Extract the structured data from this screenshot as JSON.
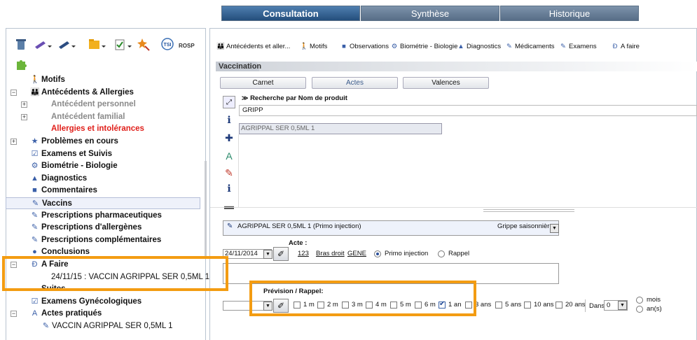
{
  "tabs": [
    {
      "label": "Consultation",
      "active": true
    },
    {
      "label": "Synthèse",
      "active": false
    },
    {
      "label": "Historique",
      "active": false
    }
  ],
  "left_toolbar": {
    "icons": [
      "trash-icon",
      "pen-blue-icon",
      "pen-dark-icon",
      "folder-icon",
      "checklist-icon",
      "star-magic-icon",
      "tsi-icon",
      "rosp-icon",
      "puzzle-icon"
    ],
    "tsi_label": "TSI",
    "rosp_label": "ROSP"
  },
  "tree": [
    {
      "label": "Motifs",
      "bold": true,
      "icon": "motifs-icon",
      "glyph": "🚶",
      "exp": "",
      "indent": 0
    },
    {
      "label": "Antécédents & Allergies",
      "bold": true,
      "icon": "antecedents-icon",
      "glyph": "👪",
      "exp": "⊟",
      "indent": 0
    },
    {
      "label": "Antécédent personnel",
      "bold": true,
      "icon": "",
      "glyph": "",
      "exp": "⊞",
      "indent": 1,
      "color": "#8a8a8a"
    },
    {
      "label": "Antécédent familial",
      "bold": true,
      "icon": "",
      "glyph": "",
      "exp": "⊞",
      "indent": 1,
      "color": "#8a8a8a"
    },
    {
      "label": "Allergies et intolérances",
      "bold": true,
      "icon": "",
      "glyph": "",
      "exp": "",
      "indent": 1,
      "color": "#e0201b"
    },
    {
      "label": "Problèmes en cours",
      "bold": true,
      "icon": "problems-icon",
      "glyph": "★",
      "exp": "⊞",
      "indent": 0
    },
    {
      "label": "Examens et Suivis",
      "bold": true,
      "icon": "exams-icon",
      "glyph": "☑",
      "exp": "",
      "indent": 0
    },
    {
      "label": "Biométrie - Biologie",
      "bold": true,
      "icon": "biometrie-icon",
      "glyph": "⚙",
      "exp": "",
      "indent": 0
    },
    {
      "label": "Diagnostics",
      "bold": true,
      "icon": "diagnostics-icon",
      "glyph": "▲",
      "exp": "",
      "indent": 0
    },
    {
      "label": "Commentaires",
      "bold": true,
      "icon": "comment-icon",
      "glyph": "■",
      "exp": "",
      "indent": 0
    },
    {
      "label": "Vaccins",
      "bold": true,
      "icon": "vaccine-icon",
      "glyph": "✎",
      "exp": "",
      "indent": 0,
      "selected": true
    },
    {
      "label": "Prescriptions pharmaceutiques",
      "bold": true,
      "icon": "prescription-icon",
      "glyph": "✎",
      "exp": "",
      "indent": 0
    },
    {
      "label": "Prescriptions d'allergènes",
      "bold": true,
      "icon": "allergen-icon",
      "glyph": "✎",
      "exp": "",
      "indent": 0
    },
    {
      "label": "Prescriptions complémentaires",
      "bold": true,
      "icon": "complementary-icon",
      "glyph": "✎",
      "exp": "",
      "indent": 0
    },
    {
      "label": "Conclusions",
      "bold": true,
      "icon": "conclusions-icon",
      "glyph": "●",
      "exp": "",
      "indent": 0
    },
    {
      "label": "A Faire",
      "bold": true,
      "icon": "todo-icon",
      "glyph": "Ð",
      "exp": "⊟",
      "indent": 0
    },
    {
      "label": "24/11/15 : VACCIN AGRIPPAL SER 0,5ML 1",
      "bold": false,
      "icon": "",
      "glyph": "",
      "exp": "",
      "indent": 1
    },
    {
      "label": "Suites",
      "bold": true,
      "icon": "",
      "glyph": "",
      "exp": "",
      "indent": 0
    },
    {
      "label": "Examens Gynécologiques",
      "bold": true,
      "icon": "gyneco-icon",
      "glyph": "☑",
      "exp": "",
      "indent": 0
    },
    {
      "label": "Actes pratiqués",
      "bold": true,
      "icon": "actes-icon",
      "glyph": "A",
      "exp": "⊟",
      "indent": 0
    },
    {
      "label": "VACCIN AGRIPPAL SER 0,5ML 1",
      "bold": false,
      "icon": "vaccine-small-icon",
      "glyph": "✎",
      "exp": "",
      "indent": 1
    }
  ],
  "right_toolbar": [
    {
      "label": "Antécédents et aller...",
      "icon": "antecedents-icon",
      "glyph": "👪"
    },
    {
      "label": "Motifs",
      "icon": "motifs-icon",
      "glyph": "🚶"
    },
    {
      "label": "Observations",
      "icon": "observations-icon",
      "glyph": "■"
    },
    {
      "label": "Biométrie - Biologie",
      "icon": "biometrie-icon",
      "glyph": "⚙"
    },
    {
      "label": "Diagnostics",
      "icon": "diagnostics-icon",
      "glyph": "▲"
    },
    {
      "label": "Médicaments",
      "icon": "medicaments-icon",
      "glyph": "✎"
    },
    {
      "label": "Examens",
      "icon": "examens-icon",
      "glyph": "✎"
    },
    {
      "label": "A faire",
      "icon": "todo-icon",
      "glyph": "Ð"
    }
  ],
  "vaccination": {
    "header": "Vaccination",
    "buttons": {
      "carnet": "Carnet",
      "actes": "Actes",
      "valences": "Valences"
    },
    "search_title": "Recherche par Nom de produit",
    "search_value": "GRIPP",
    "result": "AGRIPPAL SER 0,5ML 1",
    "product_select": "AGRIPPAL SER 0,5ML 1 (Primo injection)",
    "product_category": "Grippe saisonnière",
    "date": "24/11/2014",
    "acte_label": "Acte :",
    "acte_code": "123",
    "acte_location": "Bras droit",
    "acte_gene": "GENE",
    "radio_primo": "Primo injection",
    "radio_rappel": "Rappel",
    "prevision_label": "Prévision / Rappel:",
    "intervals": [
      {
        "label": "1 m",
        "checked": false
      },
      {
        "label": "2 m",
        "checked": false
      },
      {
        "label": "3 m",
        "checked": false
      },
      {
        "label": "4 m",
        "checked": false
      },
      {
        "label": "5 m",
        "checked": false
      },
      {
        "label": "6 m",
        "checked": false
      },
      {
        "label": "1 an",
        "checked": true
      },
      {
        "label": "3 ans",
        "checked": false
      },
      {
        "label": "5 ans",
        "checked": false
      },
      {
        "label": "10 ans",
        "checked": false
      },
      {
        "label": "20 ans",
        "checked": false
      }
    ],
    "dans_label": "Dans",
    "dans_value": "0",
    "unit_mois": "mois",
    "unit_ans": "an(s)"
  }
}
